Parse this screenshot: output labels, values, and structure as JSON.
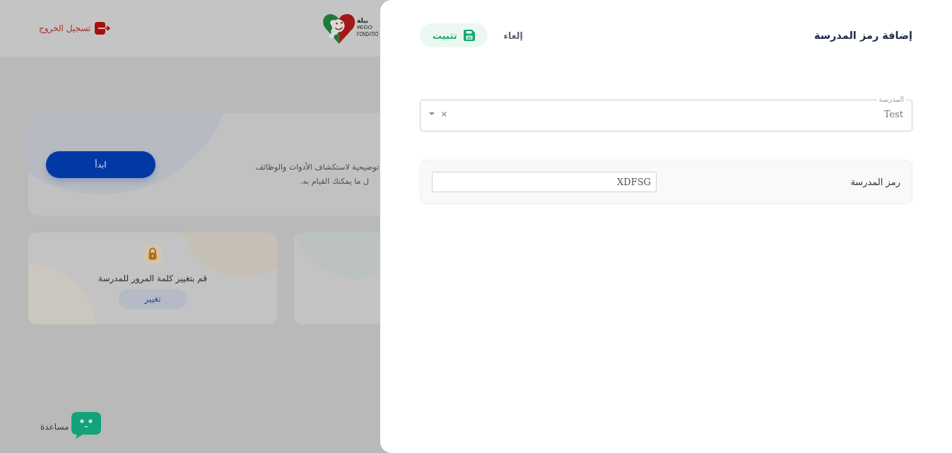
{
  "background_page": {
    "header": {
      "logout_link": "تسجيل الخروج",
      "logo_texts": [
        "بيلة",
        "#EDO",
        "FONDATIO"
      ]
    },
    "hero": {
      "start_button": "ابدأ",
      "text_lines": [
        "توضيحية لاستكشاف الأدوات والوظائف",
        "ل ما يمكنك القيام به."
      ]
    },
    "cards": [
      {
        "kind": "action",
        "text": "قم بتغيير كلمة المرور للمدرسة",
        "button": "تغيير"
      },
      {
        "kind": "cut_off"
      }
    ],
    "help": "مساعدة"
  },
  "drawer": {
    "title": "إضافة رمز المدرسة",
    "cancel_button": "إلغاء",
    "save_button": "تثبيت",
    "school_field": {
      "label": "المدرسة",
      "value": "Test"
    },
    "school_code": {
      "label": "رمز المدرسة",
      "value": "XDFSG"
    }
  }
}
